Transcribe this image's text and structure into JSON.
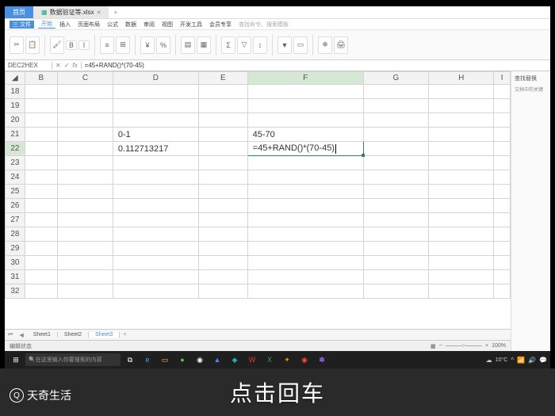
{
  "titlebar": {
    "home_tab": "首页",
    "doc_tab": "数据验证等.xlsx"
  },
  "menus": {
    "file": "三 文件",
    "items": [
      "开始",
      "插入",
      "页面布局",
      "公式",
      "数据",
      "审阅",
      "视图",
      "开发工具",
      "会员专享",
      "查找命令、搜索模板"
    ]
  },
  "ribbon": {
    "paste": "粘贴",
    "format_paint": "格式刷",
    "merge": "合并居中",
    "wrap": "自动换行"
  },
  "formula_bar": {
    "name_box": "DEC2HEX",
    "formula": "=45+RAND()*(70-45)"
  },
  "columns": [
    "B",
    "C",
    "D",
    "E",
    "F",
    "G",
    "H",
    "I"
  ],
  "rows": [
    18,
    19,
    20,
    21,
    22,
    23,
    24,
    25,
    26,
    27,
    28,
    29,
    30,
    31,
    32
  ],
  "cells": {
    "D21": "0-1",
    "D22": "0.112713217",
    "F21": "45-70",
    "F22": "=45+RAND()*(70-45)"
  },
  "active_cell": "F22",
  "sheet_tabs": {
    "tabs": [
      "Sheet1",
      "Sheet2",
      "Sheet3"
    ],
    "active": "Sheet3"
  },
  "status": {
    "left": "编辑状态",
    "zoom": "100%"
  },
  "side_panel": {
    "title": "查找替换",
    "sub": "文档中的关键"
  },
  "taskbar": {
    "search_placeholder": "在这里输入你要搜索的内容",
    "weather": "10°C",
    "time": ""
  },
  "overlay": {
    "subtitle": "点击回车",
    "watermark": "天奇生活"
  }
}
